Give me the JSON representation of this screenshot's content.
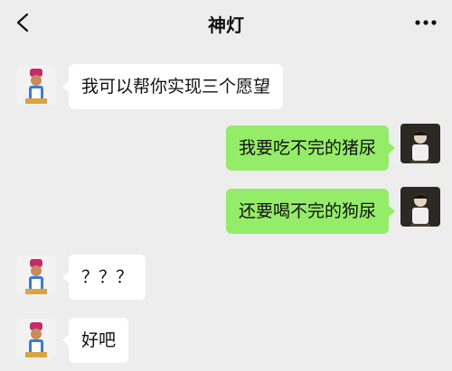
{
  "header": {
    "title": "神灯",
    "back_icon": "chevron-left-icon",
    "more_icon": "more-dots-icon"
  },
  "messages": [
    {
      "side": "left",
      "sender": "genie",
      "text": "我可以帮你实现三个愿望"
    },
    {
      "side": "right",
      "sender": "me",
      "text": "我要吃不完的猪尿"
    },
    {
      "side": "right",
      "sender": "me",
      "text": "还要喝不完的狗尿"
    },
    {
      "side": "left",
      "sender": "genie",
      "text": "？？？"
    },
    {
      "side": "left",
      "sender": "genie",
      "text": "好吧"
    }
  ],
  "colors": {
    "background": "#ededed",
    "incoming_bubble": "#ffffff",
    "outgoing_bubble": "#95ec69"
  }
}
